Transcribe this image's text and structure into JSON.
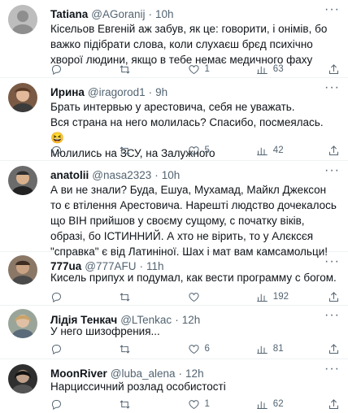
{
  "tweets": [
    {
      "name": "Tatiana",
      "handle": "@AGoranij",
      "dot": "·",
      "time": "10h",
      "text": "Кісельов Евгеній аж забув, як це: говорити, і онімів, бо важко підібрати слова, коли слухаєш брєд психічно хворої людини, якщо в тебе немає медичного фаху",
      "replies": "",
      "retweets": "",
      "likes": "1",
      "views": "63",
      "avatar_icon": "grey-avatar"
    },
    {
      "name": "Ирина",
      "handle": "@iragorod1",
      "dot": "·",
      "time": "9h",
      "text": "Брать интервью у арестовича, себя не уважать.\nВся страна на него молилась? Спасибо, посмеялась. 😆\nМолились на ЗСУ, на Залужного",
      "replies": "",
      "retweets": "",
      "likes": "5",
      "views": "42",
      "avatar_icon": "person-photo-avatar"
    },
    {
      "name": "anatolii",
      "handle": "@nasa2323",
      "dot": "·",
      "time": "10h",
      "text": "А ви не знали? Буда, Ешуа, Мухамад, Майкл Джексон то є втілення Арестовича. Нарешті людство дочекалось що ВІН прийшов у своєму сущому, с початку віків, образі, бо ІСТИННИЙ. А хто не вірить, то у Алєксєя \"справка\" є від Латиніної. Шах і мат вам камсамольци!",
      "replies": "",
      "retweets": "",
      "likes": "",
      "views": "",
      "avatar_icon": "person-photo-avatar"
    },
    {
      "name": "777ua",
      "handle": "@777AFU",
      "dot": "·",
      "time": "11h",
      "text": "Кисель припух и подумал, как вести программу с богом.",
      "replies": "",
      "retweets": "",
      "likes": "",
      "views": "192",
      "avatar_icon": "person-photo-avatar"
    },
    {
      "name": "Лідія Тенкач",
      "handle": "@LTenkac",
      "dot": "·",
      "time": "12h",
      "text": "У него шизофрения...",
      "replies": "",
      "retweets": "",
      "likes": "6",
      "views": "81",
      "avatar_icon": "person-photo-avatar"
    },
    {
      "name": "MoonRiver",
      "handle": "@luba_alena",
      "dot": "·",
      "time": "12h",
      "text": "Нарциссичний розлад особистості",
      "replies": "",
      "retweets": "",
      "likes": "1",
      "views": "62",
      "avatar_icon": "person-photo-avatar"
    }
  ],
  "more_label": "···",
  "colors": {
    "text": "#0f1419",
    "muted": "#536471",
    "divider": "#eff3f4"
  }
}
